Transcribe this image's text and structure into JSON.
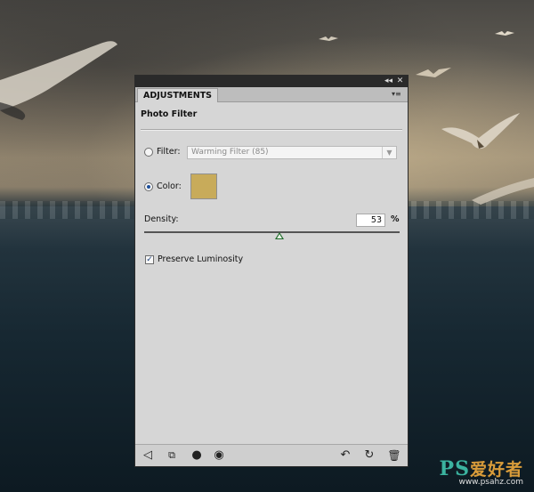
{
  "panel": {
    "tab_label": "ADJUSTMENTS",
    "section_title": "Photo Filter",
    "filter": {
      "label": "Filter:",
      "selected": "Warming Filter (85)",
      "active": false
    },
    "color": {
      "label": "Color:",
      "active": true,
      "swatch": "#c8ab5a"
    },
    "density": {
      "label": "Density:",
      "value": "53",
      "unit": "%",
      "level_percent": 53
    },
    "preserve_luminosity": {
      "label": "Preserve Luminosity",
      "checked": true
    }
  },
  "titlebar_icons": [
    "collapse-icon",
    "close-icon"
  ],
  "bottom_icons": [
    "back-arrow-icon",
    "clip-to-layer-icon",
    "visibility-toggle-icon",
    "eye-icon",
    "previous-state-icon",
    "reset-icon",
    "trash-icon"
  ],
  "watermark": {
    "logo": "PS",
    "cn": "爱好者",
    "url": "www.psahz.com"
  }
}
